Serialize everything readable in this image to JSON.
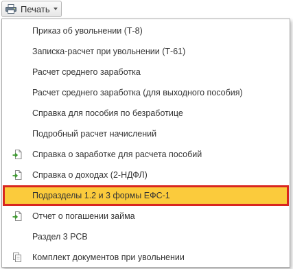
{
  "toolbar": {
    "print_label": "Печать",
    "print_icon": "printer-icon",
    "dropdown_icon": "caret-down-icon"
  },
  "menu": {
    "items": [
      {
        "label": "Приказ об увольнении (Т-8)",
        "icon": null
      },
      {
        "label": "Записка-расчет при увольнении (Т-61)",
        "icon": null
      },
      {
        "label": "Расчет среднего заработка",
        "icon": null
      },
      {
        "label": "Расчет среднего заработка (для выходного пособия)",
        "icon": null
      },
      {
        "label": "Справка для пособия по безработице",
        "icon": null
      },
      {
        "label": "Подробный расчет начислений",
        "icon": null
      },
      {
        "label": "Справка о заработке для расчета пособий",
        "icon": "document-export-icon"
      },
      {
        "label": "Справка о доходах (2-НДФЛ)",
        "icon": "document-export-icon"
      },
      {
        "label": "Подразделы 1.2 и 3 формы ЕФС-1",
        "icon": null,
        "selected": true
      },
      {
        "label": "Отчет о погашении займа",
        "icon": "document-export-icon"
      },
      {
        "label": "Раздел 3 РСВ",
        "icon": null
      },
      {
        "label": "Комплект документов при увольнении",
        "icon": "documents-set-icon"
      }
    ]
  },
  "colors": {
    "highlight_fill": "#fbcb3c",
    "highlight_border": "#d8261f",
    "icon_green": "#3d9a2f",
    "icon_gray": "#8a8a8a"
  }
}
